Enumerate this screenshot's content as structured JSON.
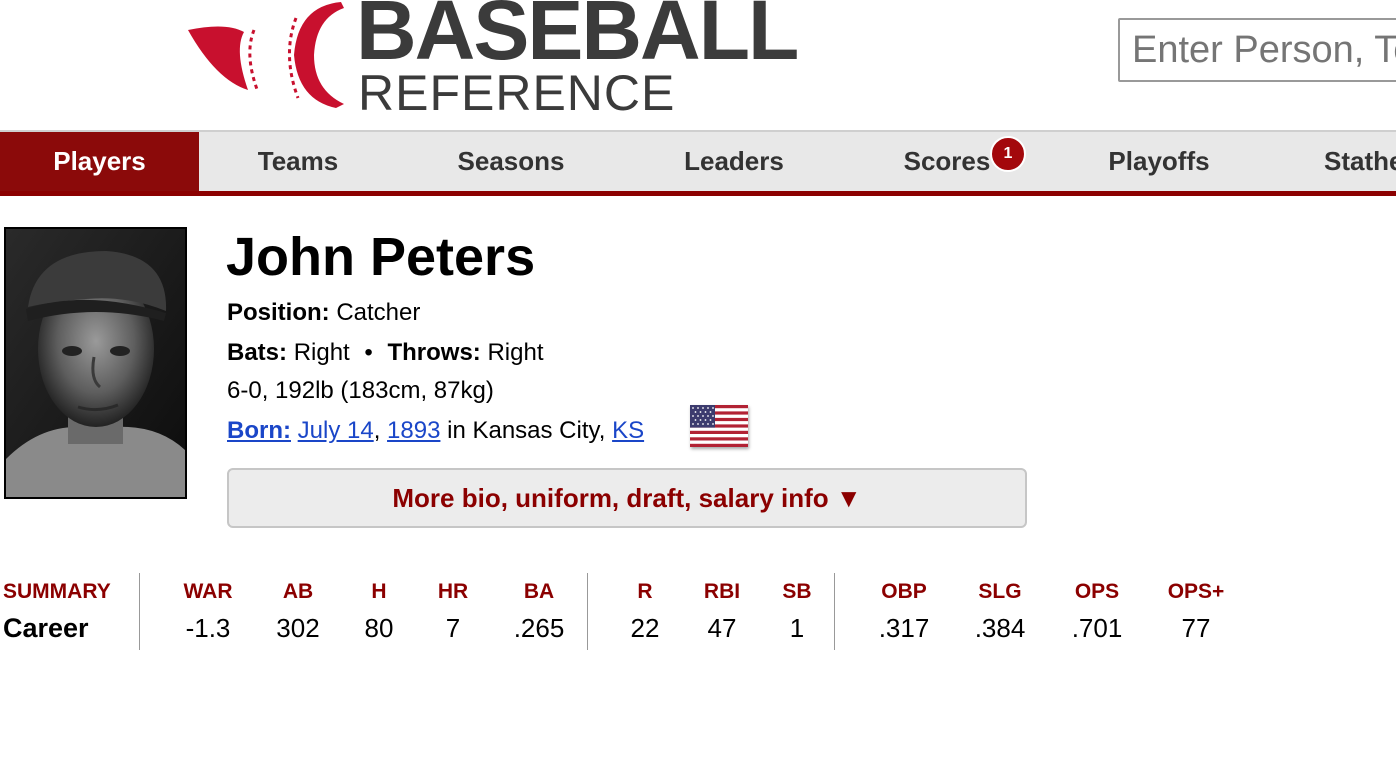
{
  "logo": {
    "line1": "BASEBALL",
    "line2": "REFERENCE",
    "brand_red": "#c8102e",
    "text_gray": "#3b3b3b"
  },
  "search": {
    "placeholder": "Enter Person, Team, Section, etc"
  },
  "nav": {
    "items": [
      {
        "label": "Players",
        "active": true
      },
      {
        "label": "Teams"
      },
      {
        "label": "Seasons"
      },
      {
        "label": "Leaders"
      },
      {
        "label": "Scores"
      },
      {
        "label": "Playoffs"
      },
      {
        "label": "Stathead"
      }
    ],
    "scores_badge": "1",
    "accent": "#8b0000"
  },
  "player": {
    "name": "John Peters",
    "position_label": "Position:",
    "position": "Catcher",
    "bats_label": "Bats:",
    "bats": "Right",
    "separator": "•",
    "throws_label": "Throws:",
    "throws": "Right",
    "size": "6-0, 192lb (183cm, 87kg)",
    "born_label": "Born:",
    "born_date": "July 14",
    "born_comma": ",",
    "born_year": "1893",
    "born_in": "in Kansas City,",
    "born_state": "KS",
    "flag_icon": "us-flag-icon",
    "more_button": "More bio, uniform, draft, salary info ▼"
  },
  "summary": {
    "header_label": "SUMMARY",
    "row_label": "Career",
    "columns": [
      {
        "h": "WAR",
        "v": "-1.3"
      },
      {
        "h": "AB",
        "v": "302"
      },
      {
        "h": "H",
        "v": "80"
      },
      {
        "h": "HR",
        "v": "7"
      },
      {
        "h": "BA",
        "v": ".265"
      },
      {
        "h": "R",
        "v": "22"
      },
      {
        "h": "RBI",
        "v": "47"
      },
      {
        "h": "SB",
        "v": "1"
      },
      {
        "h": "OBP",
        "v": ".317"
      },
      {
        "h": "SLG",
        "v": ".384"
      },
      {
        "h": "OPS",
        "v": ".701"
      },
      {
        "h": "OPS+",
        "v": "77"
      }
    ]
  }
}
